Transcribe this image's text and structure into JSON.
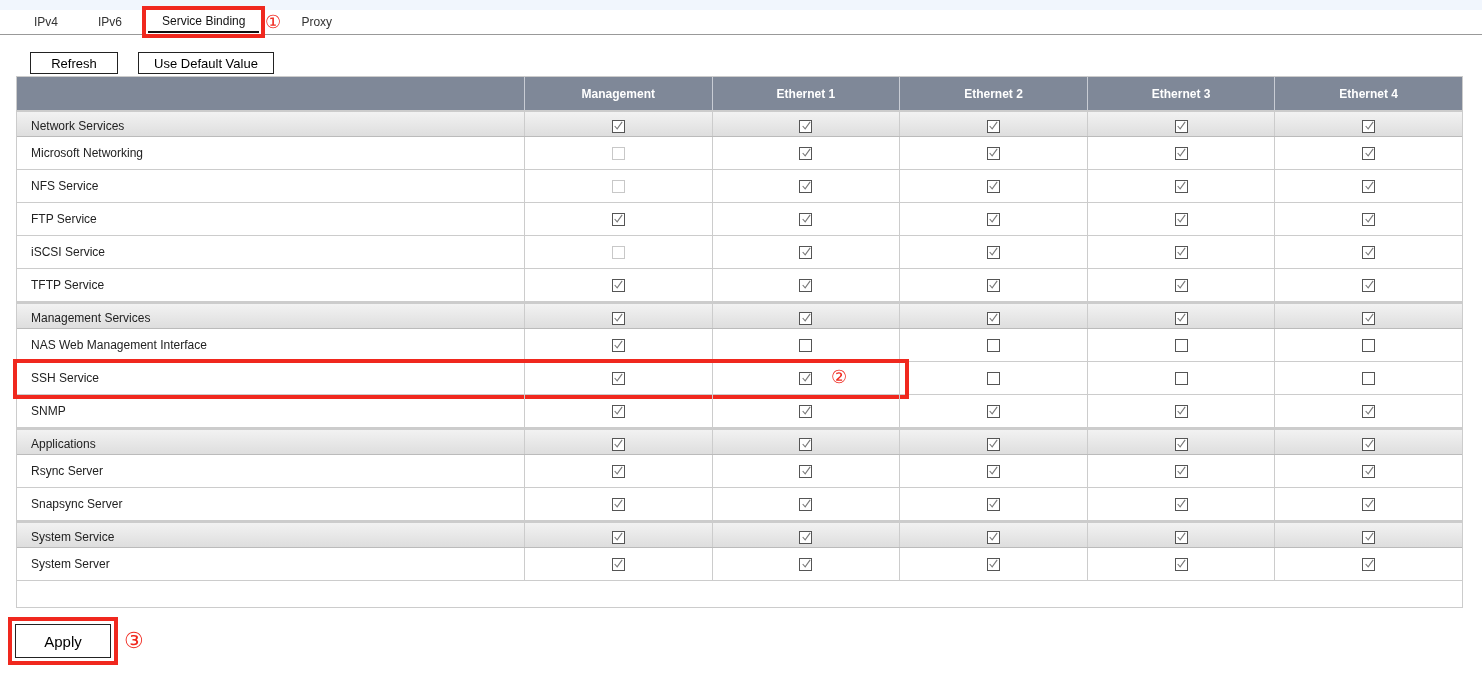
{
  "tabs": [
    {
      "label": "IPv4",
      "selected": false,
      "highlighted": false
    },
    {
      "label": "IPv6",
      "selected": false,
      "highlighted": false
    },
    {
      "label": "Service Binding",
      "selected": true,
      "highlighted": true,
      "marker": "①"
    },
    {
      "label": "Proxy",
      "selected": false,
      "highlighted": false
    }
  ],
  "toolbar": [
    "Refresh",
    "Use Default Value"
  ],
  "table": {
    "columns": [
      "Management",
      "Ethernet 1",
      "Ethernet 2",
      "Ethernet 3",
      "Ethernet 4"
    ],
    "groups": [
      {
        "label": "Network Services",
        "checks": [
          {
            "checked": true,
            "disabled": false
          },
          {
            "checked": true,
            "disabled": false
          },
          {
            "checked": true,
            "disabled": false
          },
          {
            "checked": true,
            "disabled": false
          },
          {
            "checked": true,
            "disabled": false
          }
        ],
        "items": [
          {
            "label": "Microsoft Networking",
            "highlighted": false,
            "checks": [
              {
                "checked": false,
                "disabled": true
              },
              {
                "checked": true,
                "disabled": false
              },
              {
                "checked": true,
                "disabled": false
              },
              {
                "checked": true,
                "disabled": false
              },
              {
                "checked": true,
                "disabled": false
              }
            ]
          },
          {
            "label": "NFS Service",
            "highlighted": false,
            "checks": [
              {
                "checked": false,
                "disabled": true
              },
              {
                "checked": true,
                "disabled": false
              },
              {
                "checked": true,
                "disabled": false
              },
              {
                "checked": true,
                "disabled": false
              },
              {
                "checked": true,
                "disabled": false
              }
            ]
          },
          {
            "label": "FTP Service",
            "highlighted": false,
            "checks": [
              {
                "checked": true,
                "disabled": false
              },
              {
                "checked": true,
                "disabled": false
              },
              {
                "checked": true,
                "disabled": false
              },
              {
                "checked": true,
                "disabled": false
              },
              {
                "checked": true,
                "disabled": false
              }
            ]
          },
          {
            "label": "iSCSI Service",
            "highlighted": false,
            "checks": [
              {
                "checked": false,
                "disabled": true
              },
              {
                "checked": true,
                "disabled": false
              },
              {
                "checked": true,
                "disabled": false
              },
              {
                "checked": true,
                "disabled": false
              },
              {
                "checked": true,
                "disabled": false
              }
            ]
          },
          {
            "label": "TFTP Service",
            "highlighted": false,
            "checks": [
              {
                "checked": true,
                "disabled": false
              },
              {
                "checked": true,
                "disabled": false
              },
              {
                "checked": true,
                "disabled": false
              },
              {
                "checked": true,
                "disabled": false
              },
              {
                "checked": true,
                "disabled": false
              }
            ]
          }
        ]
      },
      {
        "label": "Management Services",
        "checks": [
          {
            "checked": true,
            "disabled": false
          },
          {
            "checked": true,
            "disabled": false
          },
          {
            "checked": true,
            "disabled": false
          },
          {
            "checked": true,
            "disabled": false
          },
          {
            "checked": true,
            "disabled": false
          }
        ],
        "items": [
          {
            "label": "NAS Web Management Interface",
            "highlighted": false,
            "checks": [
              {
                "checked": true,
                "disabled": false
              },
              {
                "checked": false,
                "disabled": false
              },
              {
                "checked": false,
                "disabled": false
              },
              {
                "checked": false,
                "disabled": false
              },
              {
                "checked": false,
                "disabled": false
              }
            ]
          },
          {
            "label": "SSH Service",
            "highlighted": true,
            "marker": "②",
            "checks": [
              {
                "checked": true,
                "disabled": false
              },
              {
                "checked": true,
                "disabled": false
              },
              {
                "checked": false,
                "disabled": false
              },
              {
                "checked": false,
                "disabled": false
              },
              {
                "checked": false,
                "disabled": false
              }
            ]
          },
          {
            "label": "SNMP",
            "highlighted": false,
            "checks": [
              {
                "checked": true,
                "disabled": false
              },
              {
                "checked": true,
                "disabled": false
              },
              {
                "checked": true,
                "disabled": false
              },
              {
                "checked": true,
                "disabled": false
              },
              {
                "checked": true,
                "disabled": false
              }
            ]
          }
        ]
      },
      {
        "label": "Applications",
        "checks": [
          {
            "checked": true,
            "disabled": false
          },
          {
            "checked": true,
            "disabled": false
          },
          {
            "checked": true,
            "disabled": false
          },
          {
            "checked": true,
            "disabled": false
          },
          {
            "checked": true,
            "disabled": false
          }
        ],
        "items": [
          {
            "label": "Rsync Server",
            "highlighted": false,
            "checks": [
              {
                "checked": true,
                "disabled": false
              },
              {
                "checked": true,
                "disabled": false
              },
              {
                "checked": true,
                "disabled": false
              },
              {
                "checked": true,
                "disabled": false
              },
              {
                "checked": true,
                "disabled": false
              }
            ]
          },
          {
            "label": "Snapsync Server",
            "highlighted": false,
            "checks": [
              {
                "checked": true,
                "disabled": false
              },
              {
                "checked": true,
                "disabled": false
              },
              {
                "checked": true,
                "disabled": false
              },
              {
                "checked": true,
                "disabled": false
              },
              {
                "checked": true,
                "disabled": false
              }
            ]
          }
        ]
      },
      {
        "label": "System Service",
        "checks": [
          {
            "checked": true,
            "disabled": false
          },
          {
            "checked": true,
            "disabled": false
          },
          {
            "checked": true,
            "disabled": false
          },
          {
            "checked": true,
            "disabled": false
          },
          {
            "checked": true,
            "disabled": false
          }
        ],
        "items": [
          {
            "label": "System Server",
            "highlighted": false,
            "checks": [
              {
                "checked": true,
                "disabled": false
              },
              {
                "checked": true,
                "disabled": false
              },
              {
                "checked": true,
                "disabled": false
              },
              {
                "checked": true,
                "disabled": false
              },
              {
                "checked": true,
                "disabled": false
              }
            ]
          }
        ]
      }
    ]
  },
  "apply": {
    "label": "Apply",
    "highlighted": true,
    "marker": "③"
  }
}
